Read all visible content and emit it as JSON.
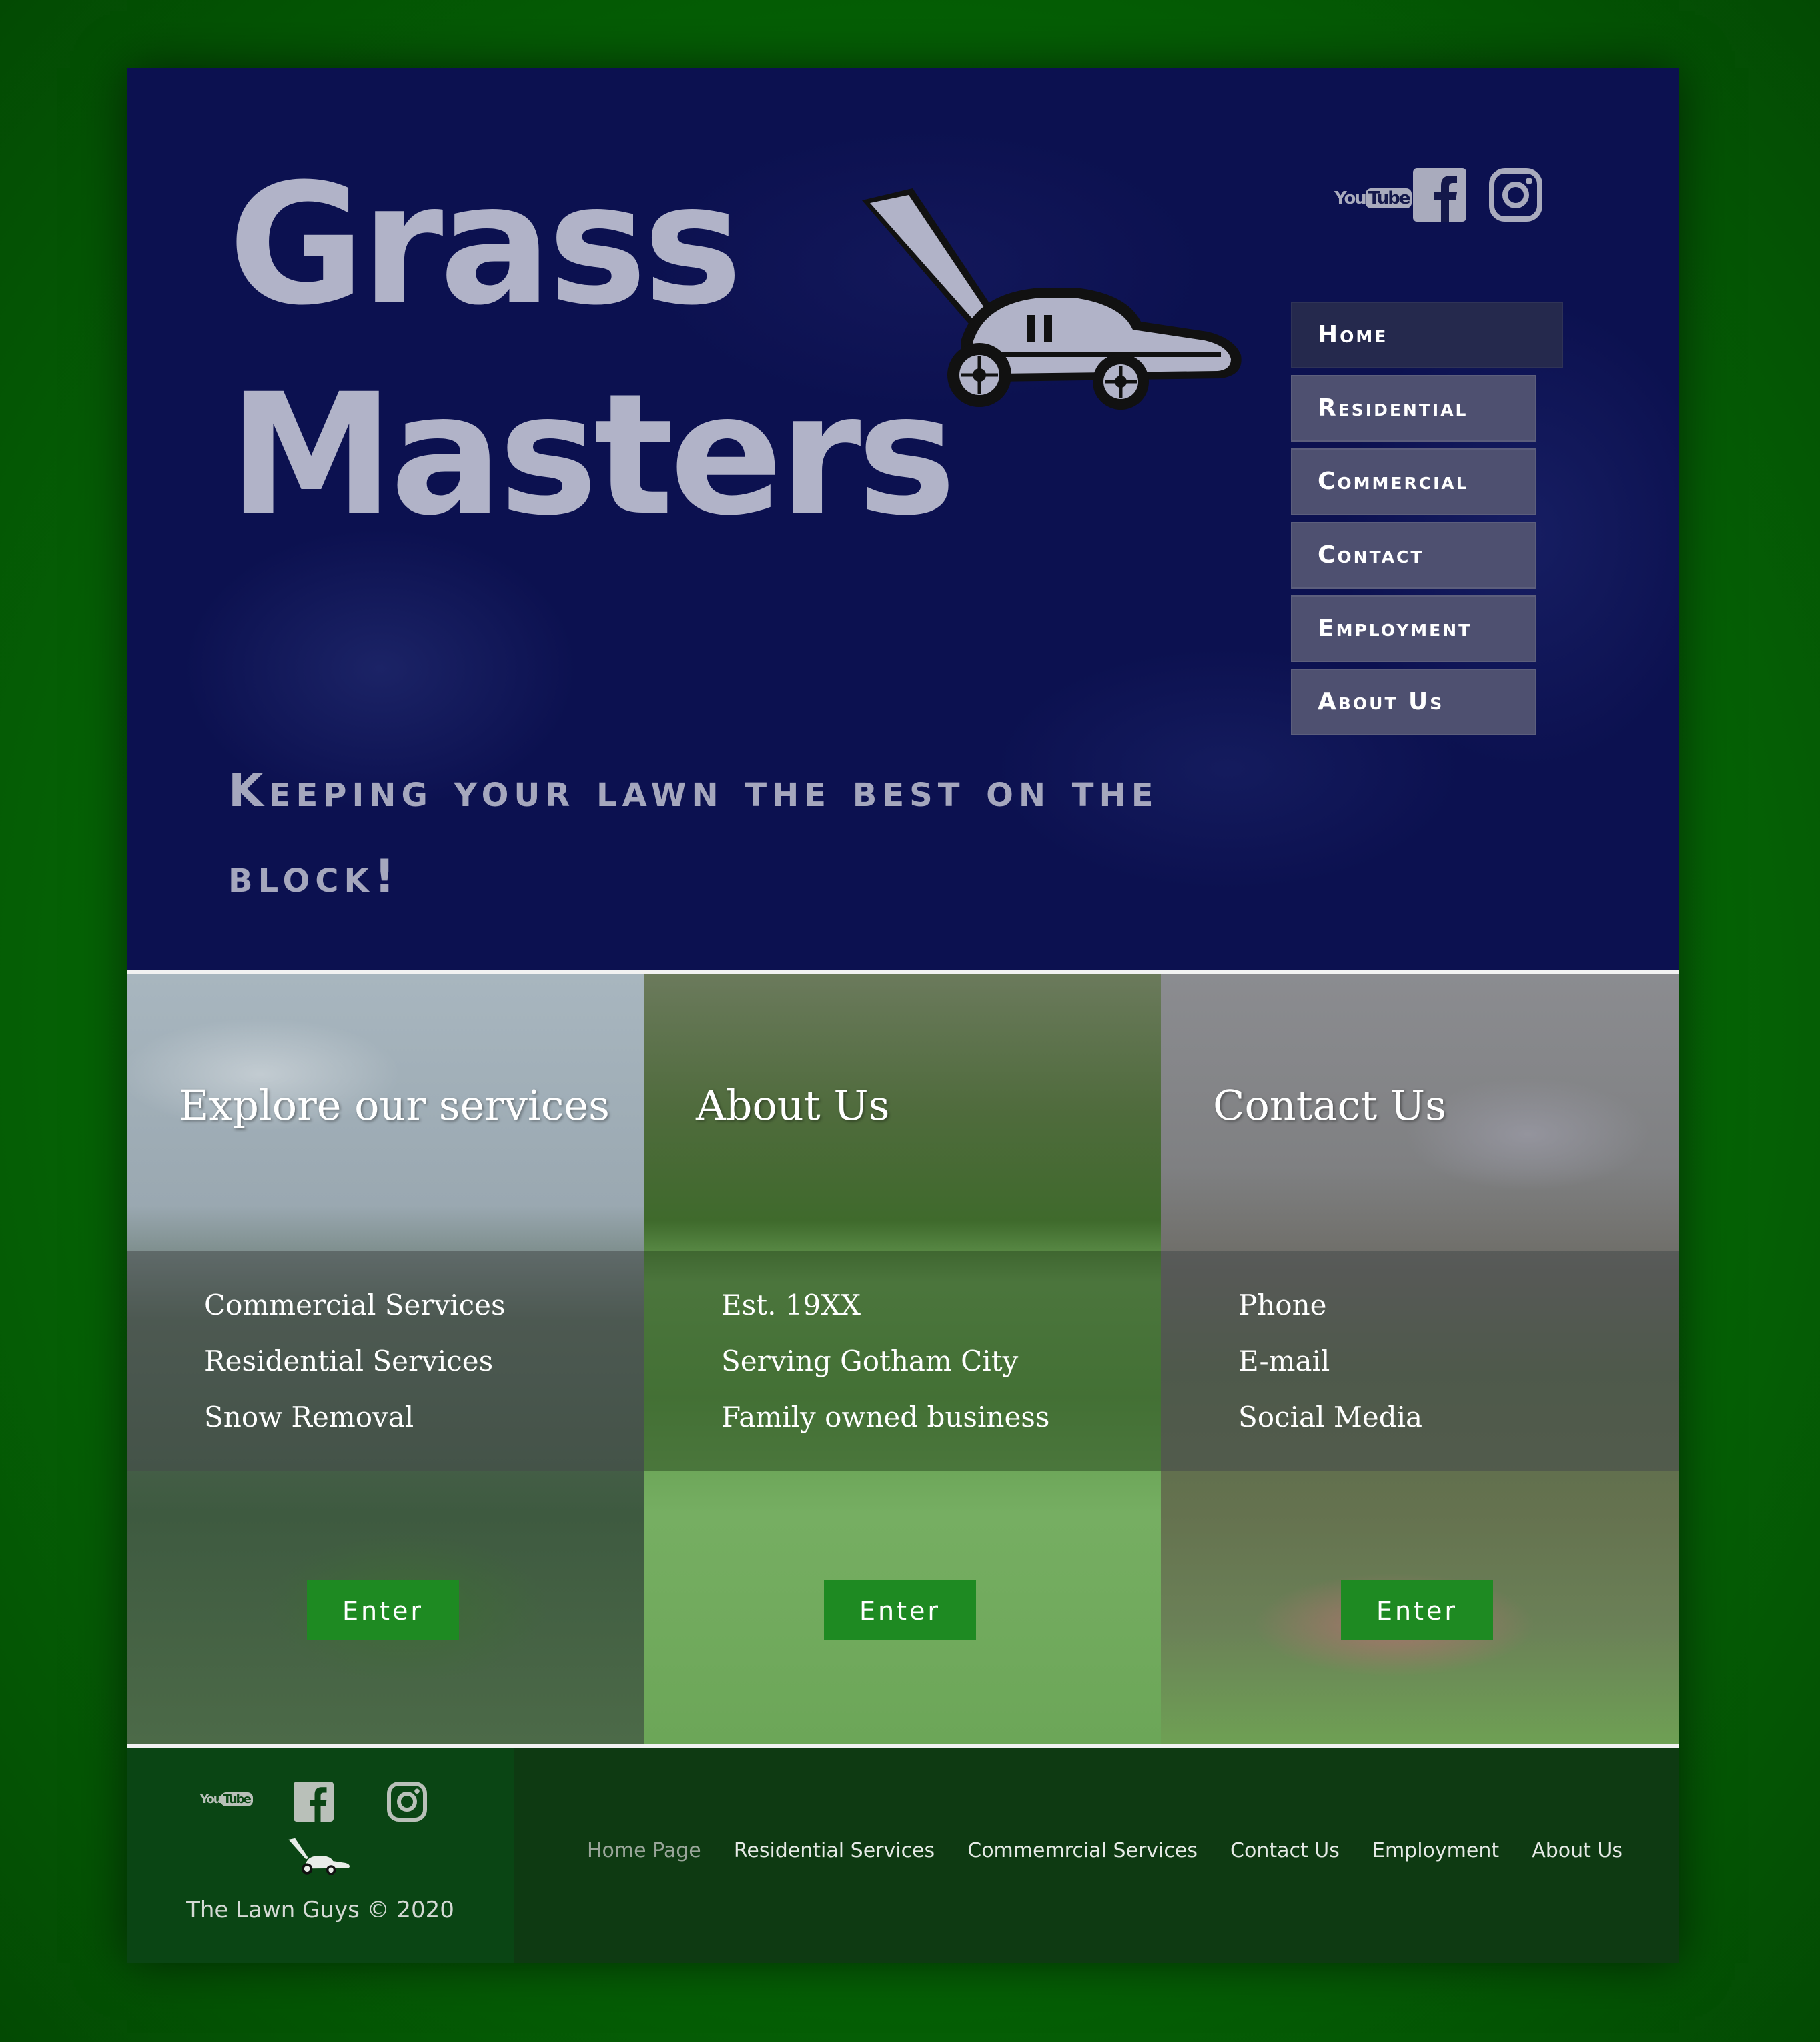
{
  "brand": {
    "line1": "Grass",
    "line2": "Masters",
    "tagline": "Keeping your lawn the best on the block!"
  },
  "social": {
    "youtube_a": "You",
    "youtube_b": "Tube",
    "icons": [
      "youtube-icon",
      "facebook-icon",
      "instagram-icon"
    ]
  },
  "nav": {
    "items": [
      {
        "label": "Home"
      },
      {
        "label": "Residential"
      },
      {
        "label": "Commercial"
      },
      {
        "label": "Contact"
      },
      {
        "label": "Employment"
      },
      {
        "label": "About Us"
      }
    ]
  },
  "cards": [
    {
      "title": "Explore our services",
      "items": [
        "Commercial Services",
        "Residential Services",
        "Snow Removal"
      ],
      "button": "Enter"
    },
    {
      "title": "About Us",
      "items": [
        "Est. 19XX",
        "Serving Gotham City",
        "Family owned business"
      ],
      "button": "Enter"
    },
    {
      "title": "Contact Us",
      "items": [
        "Phone",
        "E-mail",
        "Social Media"
      ],
      "button": "Enter"
    }
  ],
  "footer": {
    "copyright": "The Lawn Guys © 2020",
    "links": [
      {
        "label": "Home Page"
      },
      {
        "label": "Residential Services"
      },
      {
        "label": "Commemrcial Services"
      },
      {
        "label": "Contact Us"
      },
      {
        "label": "Employment"
      },
      {
        "label": "About Us"
      }
    ]
  },
  "colors": {
    "page_green": "#066806",
    "hero_navy": "#0c1150",
    "brand_gray": "#b1b3c8",
    "nav_button": "#4e5070",
    "nav_active": "#25294d",
    "enter_button": "#1e8a22",
    "footer_dark": "#0e3a12",
    "footer_left": "#0a4514"
  }
}
